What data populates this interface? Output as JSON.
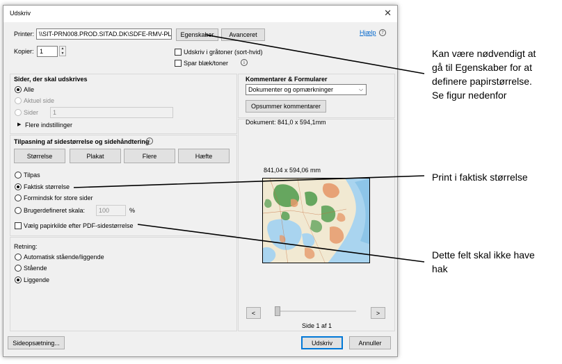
{
  "window": {
    "title": "Udskriv",
    "close_glyph": "✕"
  },
  "printer": {
    "label": "Printer:",
    "value": "\\\\SIT-PRN008.PROD.SITAD.DK\\SDFE-RMV-PL",
    "properties_button": "Egenskaber",
    "advanced_button": "Avanceret"
  },
  "help": {
    "label": "Hjælp",
    "icon_glyph": "?"
  },
  "copies": {
    "label": "Kopier:",
    "value": "1"
  },
  "options": {
    "grayscale": "Udskriv i gråtoner (sort-hvid)",
    "save_ink": "Spar blæk/toner",
    "info_glyph": "i"
  },
  "pages": {
    "heading": "Sider, der skal udskrives",
    "all": "Alle",
    "current": "Aktuel side",
    "pages_label": "Sider",
    "pages_value": "1",
    "more": "Flere indstillinger",
    "more_glyph": "▶"
  },
  "sizing": {
    "heading": "Tilpasning af sidestørrelse og sidehåndtering",
    "tabs": [
      "Størrelse",
      "Plakat",
      "Flere",
      "Hæfte"
    ],
    "fit": "Tilpas",
    "actual": "Faktisk størrelse",
    "shrink": "Formindsk for store sider",
    "custom": "Brugerdefineret skala:",
    "custom_value": "100",
    "percent": "%",
    "paper_source": "Vælg papirkilde efter PDF-sidestørrelse"
  },
  "orientation": {
    "heading": "Retning:",
    "auto": "Automatisk stående/liggende",
    "portrait": "Stående",
    "landscape": "Liggende"
  },
  "comments": {
    "heading": "Kommentarer & Formularer",
    "select_value": "Dokumenter og opmærkninger",
    "summarize_button": "Opsummer kommentarer"
  },
  "preview": {
    "document_size": "Dokument: 841,0 x 594,1mm",
    "page_size": "841,04 x 594,06 mm",
    "prev": "<",
    "next": ">",
    "page_counter": "Side 1 af 1"
  },
  "footer": {
    "page_setup": "Sideopsætning...",
    "print": "Udskriv",
    "cancel": "Annuller"
  },
  "annotations": {
    "properties_note": [
      "Kan være nødvendigt at",
      "gå til Egenskaber for at",
      "definere papirstørrelse.",
      "Se figur nedenfor"
    ],
    "actual_size_note": "Print i faktisk størrelse",
    "paper_source_note": [
      "Dette felt skal ikke have",
      "hak"
    ]
  },
  "colors": {
    "dialog_bg": "#f0f0f0",
    "accent_blue": "#0078d7",
    "link_blue": "#0066cc",
    "map_water": "#a9d4ef",
    "map_land": "#f1e9d2",
    "map_forest": "#4e9a4b",
    "map_urban": "#e69a6c"
  }
}
